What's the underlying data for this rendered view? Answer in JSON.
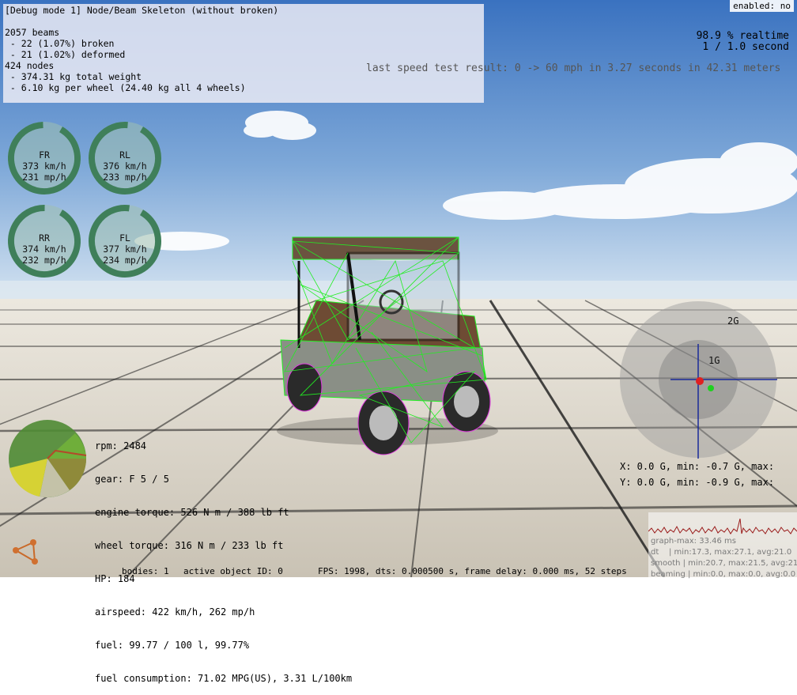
{
  "debug": {
    "title": "[Debug mode 1] Node/Beam Skeleton (without broken)",
    "beams": "2057 beams",
    "broken": " - 22 (1.07%) broken",
    "deformed": " - 21 (1.02%) deformed",
    "nodes": "424 nodes",
    "weight": " - 374.31 kg total weight",
    "per_wheel": " - 6.10 kg per wheel (24.40 kg all 4 wheels)"
  },
  "enabled": "enabled: no",
  "realtime": "98.9 % realtime",
  "second": "1 / 1.0 second",
  "speedtest": "last speed test result: 0 -> 60 mph in 3.27 seconds in 42.31 meters",
  "wheels": [
    {
      "name": "FR",
      "kmh": "373 km/h",
      "mph": "231 mp/h"
    },
    {
      "name": "RL",
      "kmh": "376 km/h",
      "mph": "233 mp/h"
    },
    {
      "name": "RR",
      "kmh": "374 km/h",
      "mph": "232 mp/h"
    },
    {
      "name": "FL",
      "kmh": "377 km/h",
      "mph": "234 mp/h"
    }
  ],
  "engine": {
    "rpm": "rpm: 2484",
    "gear": "gear: F 5 / 5",
    "engine_torque": "engine torque: 526 N m / 388 lb ft",
    "wheel_torque": "wheel torque: 316 N m / 233 lb ft",
    "hp": "HP: 184",
    "airspeed": "airspeed: 422 km/h, 262 mp/h",
    "fuel": "fuel: 99.77 / 100 l, 99.77%",
    "consumption": "fuel consumption: 71.02 MPG(US), 3.31 L/100km"
  },
  "gforce": {
    "label_2g": "2G",
    "label_1g": "1G",
    "x": "X: 0.0 G, min: -0.7 G, max:",
    "y": "Y: 0.0 G, min: -0.9 G, max:"
  },
  "status": {
    "bodies": "bodies: 1",
    "active": "active object ID: 0",
    "fps": "FPS: 1998, dts: 0.000500 s, frame delay: 0.000 ms, 52 steps"
  },
  "graph": {
    "max": "graph-max: 33.46 ms",
    "dt": "dt    | min:17.3, max:27.1, avg:21.0",
    "smooth": "smooth | min:20.7, max:21.5, avg:21.0",
    "beaming": "beaming | min:0.0, max:0.0, avg:0.0"
  },
  "colors": {
    "sky_top": "#3f78c4",
    "sky_bottom": "#cfe0f0",
    "floor": "#d8d2c6",
    "wireframe": "#22ee22",
    "gauge": "#3f7f5a"
  }
}
